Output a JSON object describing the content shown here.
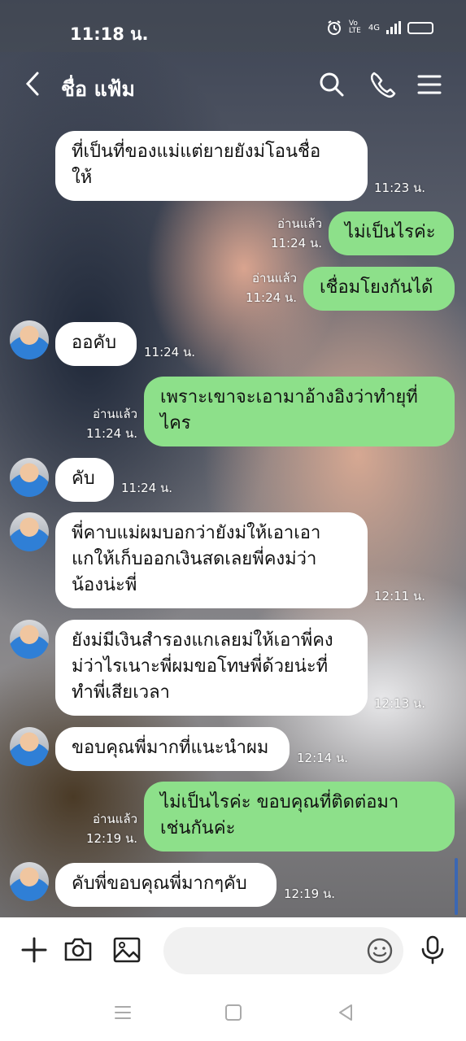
{
  "status_bar": {
    "time": "11:18 น.",
    "network": "4G",
    "volte": "Vo LTE"
  },
  "header": {
    "contact_name": "ชื่อ แฟ้ม"
  },
  "messages": [
    {
      "side": "in",
      "text_lines": [
        "ที่เป็นที่ของแม่แต่ยายยังม่โอนชื่อ",
        "ให้"
      ],
      "time": "11:23 น."
    },
    {
      "side": "out",
      "text_lines": [
        "ไม่เป็นไรค่ะ"
      ],
      "read": "อ่านแล้ว",
      "time": "11:24 น."
    },
    {
      "side": "out",
      "text_lines": [
        "เชื่อมโยงกันได้"
      ],
      "read": "อ่านแล้ว",
      "time": "11:24 น."
    },
    {
      "side": "in",
      "text_lines": [
        "ออคับ"
      ],
      "time": "11:24 น."
    },
    {
      "side": "out",
      "text_lines": [
        "เพราะเขาจะเอามาอ้างอิงว่าทำยุที่",
        "ไคร"
      ],
      "read": "อ่านแล้ว",
      "time": "11:24 น."
    },
    {
      "side": "in",
      "text_lines": [
        "คับ"
      ],
      "time": "11:24 น."
    },
    {
      "side": "in",
      "text_lines": [
        "พี่คาบแม่ผมบอกว่ายังม่ให้เอาเอา",
        "แกให้เก็บออกเงินสดเลยพี่คงม่ว่า",
        "น้องน่ะพี่"
      ],
      "time": "12:11 น."
    },
    {
      "side": "in",
      "text_lines": [
        "ยังม่มีเงินสำรองแกเลยม่ให้เอาพี่คง",
        "ม่ว่าไรเนาะพี่ผมขอโทษพี่ด้วยน่ะที่",
        "ทำพี่เสียเวลา"
      ],
      "time": "12:13 น."
    },
    {
      "side": "in",
      "text_lines": [
        "ขอบคุณพี่มากที่แนะนำผม"
      ],
      "time": "12:14 น."
    },
    {
      "side": "out",
      "text_lines": [
        "ไม่เป็นไรค่ะ ขอบคุณที่ติดต่อมา",
        "เช่นกันค่ะ"
      ],
      "read": "อ่านแล้ว",
      "time": "12:19 น."
    },
    {
      "side": "in",
      "text_lines": [
        "คับพี่ขอบคุณพี่มากๆคับ"
      ],
      "time": "12:19 น."
    }
  ],
  "input": {
    "placeholder": ""
  },
  "colors": {
    "outgoing_bubble": "#8de08a",
    "incoming_bubble": "#ffffff",
    "battery": "#f2b51c"
  },
  "icons": [
    "back-icon",
    "search-icon",
    "phone-icon",
    "menu-icon",
    "plus-icon",
    "camera-icon",
    "image-icon",
    "emoji-icon",
    "mic-icon",
    "nav-menu-icon",
    "nav-home-icon",
    "nav-back-icon"
  ]
}
